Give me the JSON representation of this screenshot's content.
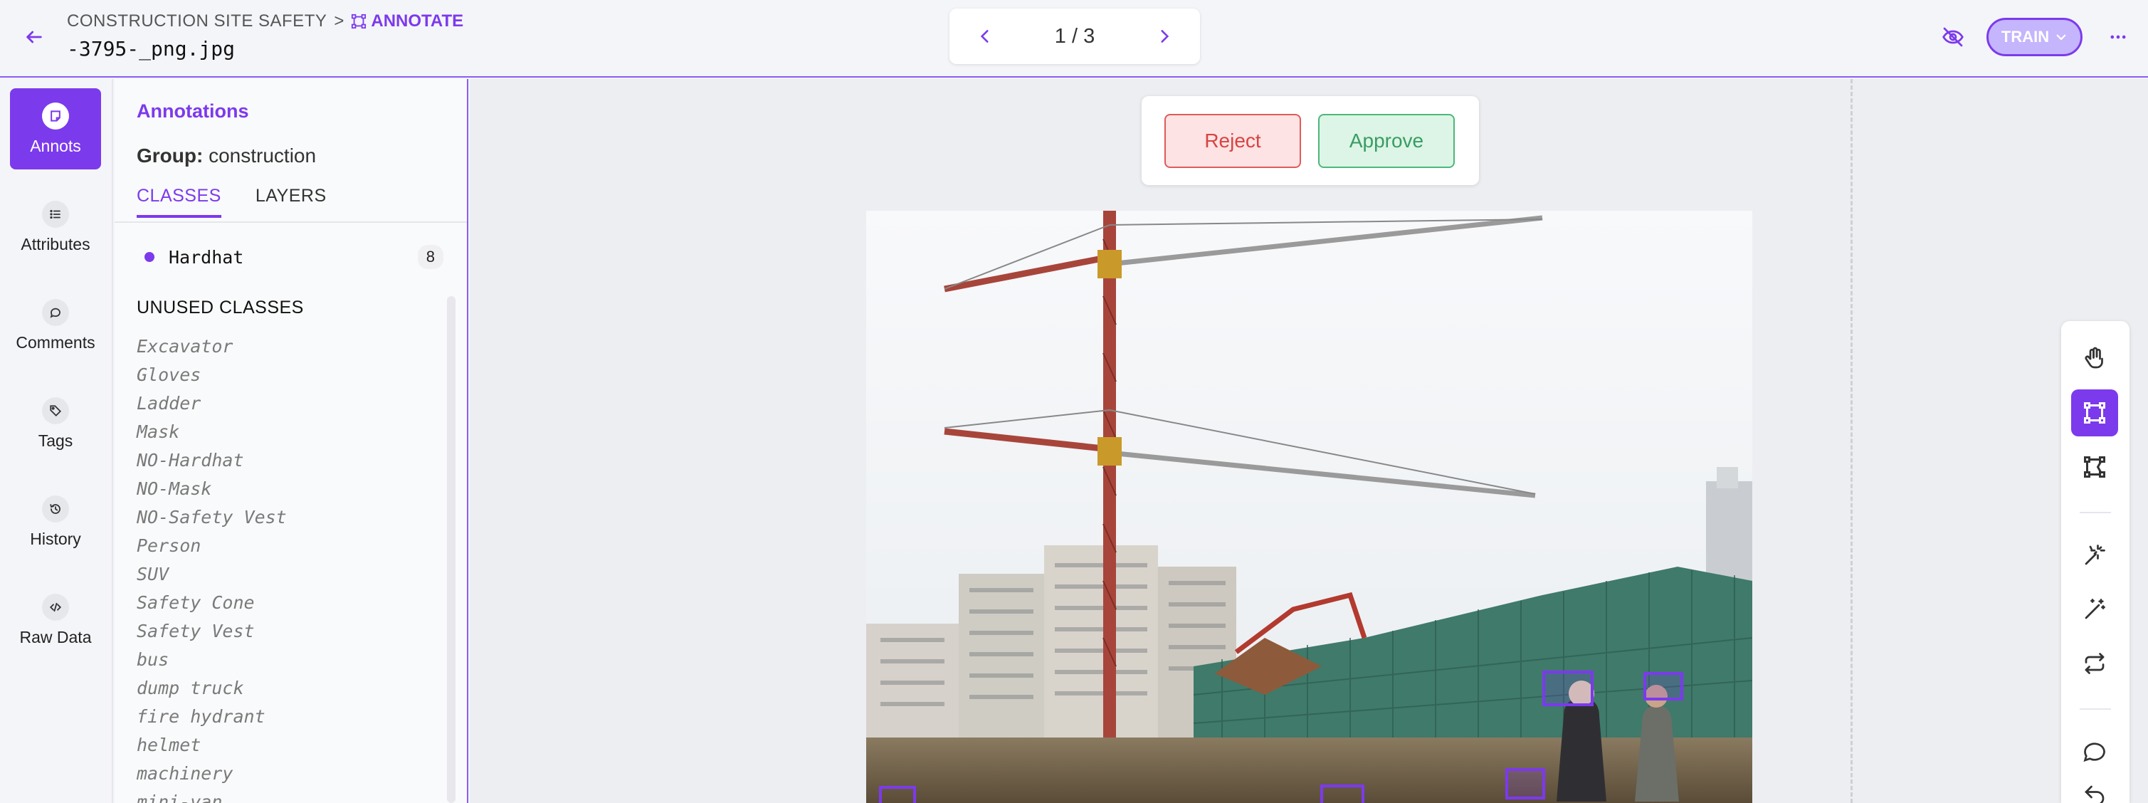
{
  "header": {
    "project": "CONSTRUCTION SITE SAFETY",
    "separator": ">",
    "mode": "ANNOTATE",
    "filename": "-3795-_png.jpg",
    "pager": "1 / 3",
    "train_label": "TRAIN"
  },
  "rail": {
    "items": [
      {
        "label": "Annots",
        "icon": "annotation-icon",
        "active": true
      },
      {
        "label": "Attributes",
        "icon": "list-icon"
      },
      {
        "label": "Comments",
        "icon": "comment-icon"
      },
      {
        "label": "Tags",
        "icon": "tag-icon"
      },
      {
        "label": "History",
        "icon": "history-icon"
      },
      {
        "label": "Raw Data",
        "icon": "code-icon"
      }
    ]
  },
  "panel": {
    "title": "Annotations",
    "group_label": "Group:",
    "group_value": "construction",
    "tabs": [
      {
        "label": "CLASSES",
        "active": true
      },
      {
        "label": "LAYERS"
      }
    ],
    "used_classes": [
      {
        "name": "Hardhat",
        "count": "8",
        "color": "#7c3aed"
      }
    ],
    "unused_title": "UNUSED CLASSES",
    "unused_classes": [
      "Excavator",
      "Gloves",
      "Ladder",
      "Mask",
      "NO-Hardhat",
      "NO-Mask",
      "NO-Safety Vest",
      "Person",
      "SUV",
      "Safety Cone",
      "Safety Vest",
      "bus",
      "dump truck",
      "fire hydrant",
      "helmet",
      "machinery",
      "mini-van"
    ]
  },
  "review": {
    "reject_label": "Reject",
    "approve_label": "Approve"
  },
  "tools": [
    "hand-icon",
    "bounding-box-icon",
    "polygon-icon",
    "smart-select-icon",
    "magic-wand-icon",
    "repeat-icon",
    "comment-icon",
    "undo-icon"
  ],
  "colors": {
    "accent": "#7c3aed",
    "reject": "#d84343",
    "approve": "#3a9c63"
  }
}
